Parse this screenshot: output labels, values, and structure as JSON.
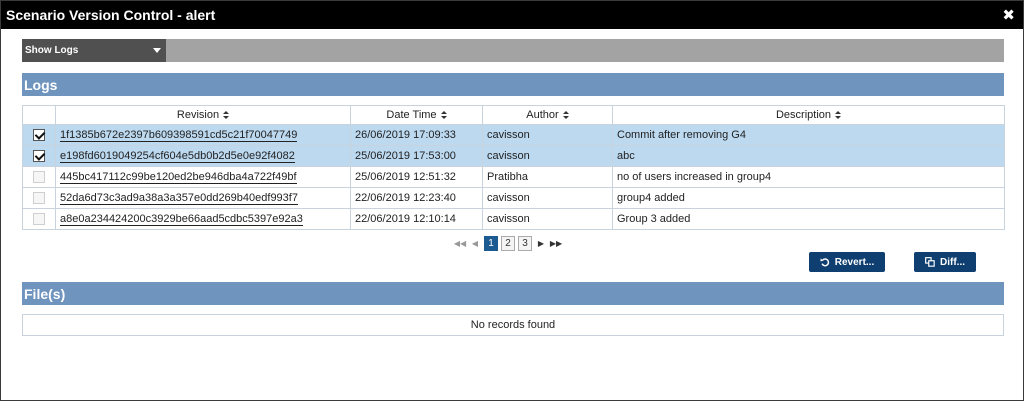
{
  "window": {
    "title": "Scenario Version Control - alert"
  },
  "toolbar": {
    "dropdown_value": "Show Logs"
  },
  "logs_section": {
    "title": "Logs"
  },
  "logs_table": {
    "columns": [
      "",
      "Revision",
      "Date Time",
      "Author",
      "Description"
    ],
    "rows": [
      {
        "checked": true,
        "selected": true,
        "revision": "1f1385b672e2397b609398591cd5c21f70047749",
        "datetime": "26/06/2019 17:09:33",
        "author": "cavisson",
        "description": "Commit after removing G4"
      },
      {
        "checked": true,
        "selected": true,
        "revision": "e198fd6019049254cf604e5db0b2d5e0e92f4082",
        "datetime": "25/06/2019 17:53:00",
        "author": "cavisson",
        "description": "abc"
      },
      {
        "checked": false,
        "selected": false,
        "revision": "445bc417112c99be120ed2be946dba4a722f49bf",
        "datetime": "25/06/2019 12:51:32",
        "author": "Pratibha",
        "description": "no of users increased in group4"
      },
      {
        "checked": false,
        "selected": false,
        "revision": "52da6d73c3ad9a38a3a357e0dd269b40edf993f7",
        "datetime": "22/06/2019 12:23:40",
        "author": "cavisson",
        "description": "group4 added"
      },
      {
        "checked": false,
        "selected": false,
        "revision": "a8e0a234424200c3929be66aad5cdbc5397e92a3",
        "datetime": "22/06/2019 12:10:14",
        "author": "cavisson",
        "description": "Group 3 added"
      }
    ]
  },
  "paginator": {
    "pages": [
      "1",
      "2",
      "3"
    ],
    "current": "1"
  },
  "actions": {
    "revert_label": "Revert...",
    "diff_label": "Diff..."
  },
  "files_section": {
    "title": "File(s)",
    "empty_message": "No records found"
  },
  "colors": {
    "section_bar": "#6f94be",
    "button": "#0e3f70",
    "selected_row": "#bcd9f0",
    "title_bar": "#000000"
  }
}
